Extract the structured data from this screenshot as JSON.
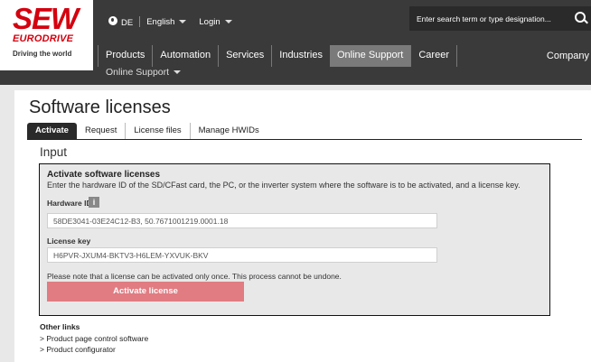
{
  "logo": {
    "main": "SEW",
    "sub": "EURODRIVE",
    "tagline": "Driving the world"
  },
  "topbar": {
    "country": "DE",
    "language": "English",
    "login": "Login"
  },
  "search": {
    "placeholder": "Enter search term or type designation..."
  },
  "nav": {
    "items": [
      "Products",
      "Automation",
      "Services",
      "Industries",
      "Online Support",
      "Career"
    ],
    "active": "Online Support",
    "company": "Company"
  },
  "subnav": {
    "label": "Online Support"
  },
  "page": {
    "title": "Software licenses"
  },
  "tabs": [
    {
      "label": "Activate",
      "active": true
    },
    {
      "label": "Request"
    },
    {
      "label": "License files"
    },
    {
      "label": "Manage HWIDs"
    }
  ],
  "input_section": {
    "title": "Input"
  },
  "panel": {
    "heading": "Activate software licenses",
    "description": "Enter the hardware ID of the SD/CFast card, the PC, or the inverter system where the software is to be activated, and a license key.",
    "hardware_id_label": "Hardware ID",
    "hardware_id_value": "58DE3041-03E24C12-B3, 50.7671001219.0001.18",
    "license_key_label": "License key",
    "license_key_value": "H6PVR-JXUM4-BKTV3-H6LEM-YXVUK-BKV",
    "note": "Please note that a license can be activated only once. This process cannot be undone.",
    "button": "Activate license"
  },
  "other_links": {
    "heading": "Other links",
    "links": [
      "> Product page control software",
      "> Product configurator"
    ]
  },
  "colors": {
    "header": "#3a3a3a",
    "brand_red": "#d4000f",
    "button": "#e07c82",
    "active_nav": "#7a7a7a"
  }
}
